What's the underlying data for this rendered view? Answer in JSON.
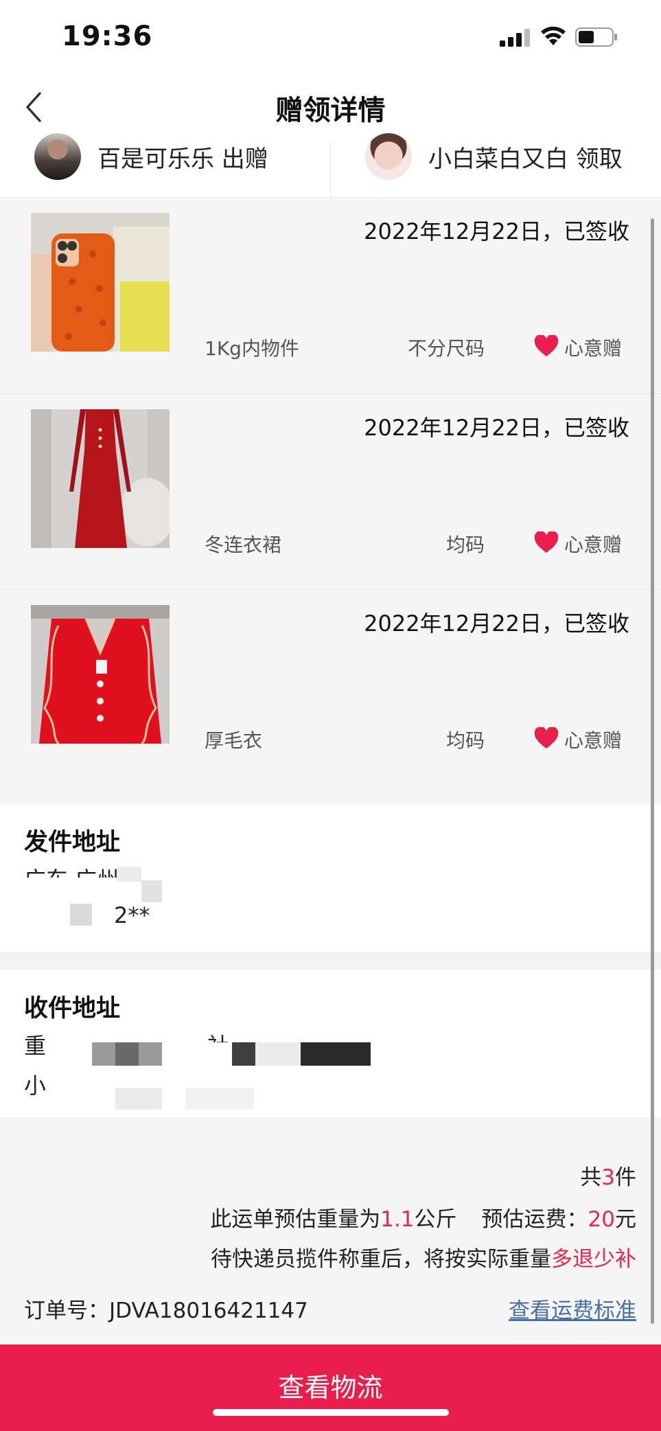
{
  "status_bar": {
    "time": "19:36"
  },
  "nav": {
    "title": "赠领详情"
  },
  "parties": {
    "giver": "百是可乐乐 出赠",
    "receiver": "小白菜白又白 领取"
  },
  "items": [
    {
      "date": "2022年12月22日，已签收",
      "name": "1Kg内物件",
      "size": "不分尺码",
      "tag": "心意赠"
    },
    {
      "date": "2022年12月22日，已签收",
      "name": "冬连衣裙",
      "size": "均码",
      "tag": "心意赠"
    },
    {
      "date": "2022年12月22日，已签收",
      "name": "厚毛衣",
      "size": "均码",
      "tag": "心意赠"
    }
  ],
  "sender_address": {
    "title": "发件地址",
    "line1": "广东 广州",
    "line2": "2**"
  },
  "receiver_address": {
    "title": "收件地址",
    "line1_prefix": "重",
    "line1_mid": "社",
    "line2_prefix": "小"
  },
  "summary": {
    "count_prefix": "共",
    "count": "3",
    "count_suffix": "件",
    "weight_prefix": "此运单预估重量为",
    "weight_value": "1.1",
    "weight_unit": "公斤",
    "fee_label": "预估运费：",
    "fee_value": "20",
    "fee_unit": "元",
    "note_prefix": "待快递员揽件称重后，将按实际重量",
    "note_highlight": "多退少补"
  },
  "order": {
    "label": "订单号：",
    "number": "JDVA18016421147",
    "fee_link": "查看运费标准"
  },
  "cta": {
    "label": "查看物流"
  },
  "colors": {
    "accent": "#ea1e4d",
    "link": "#4a6fa5",
    "list_bg": "#f5f5f5"
  }
}
